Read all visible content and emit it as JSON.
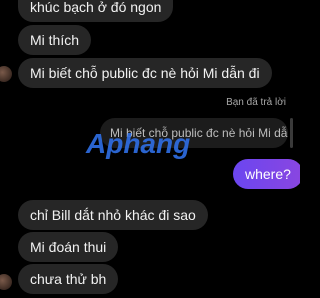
{
  "messages_incoming_top": [
    {
      "text": "khúc bạch ở đó ngon"
    },
    {
      "text": "Mi thích"
    },
    {
      "text": "Mi biết chỗ public đc nè hỏi Mi dẫn đi"
    }
  ],
  "reply": {
    "label": "Bạn đã trả lời",
    "quoted_text": "Mi biết chỗ public đc nè hỏi Mi dẫn đi"
  },
  "outgoing_message": {
    "text": "where?"
  },
  "messages_incoming_bottom": [
    {
      "text": "chỉ Bill dắt nhỏ khác đi sao"
    },
    {
      "text": "Mi đoán thui"
    },
    {
      "text": "chưa thử bh"
    }
  ],
  "watermark": {
    "text": "Aphang"
  },
  "colors": {
    "background": "#000000",
    "incoming_bubble": "#262626",
    "outgoing_bubble": "#7a44e8",
    "watermark": "#2f6fe6"
  }
}
